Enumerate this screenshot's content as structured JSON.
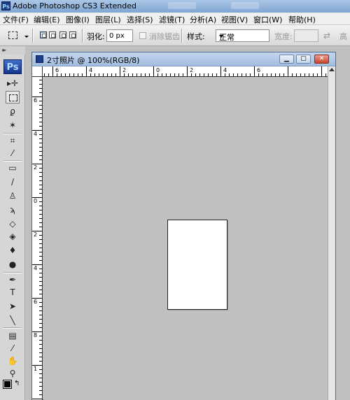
{
  "app": {
    "title": "Adobe Photoshop CS3 Extended",
    "icon_label": "Ps"
  },
  "menu": [
    "文件(F)",
    "编辑(E)",
    "图像(I)",
    "图层(L)",
    "选择(S)",
    "滤镜(T)",
    "分析(A)",
    "视图(V)",
    "窗口(W)",
    "帮助(H)"
  ],
  "options": {
    "feather_label": "羽化:",
    "feather_value": "0 px",
    "antialias_label": "消除锯齿",
    "style_label": "样式:",
    "style_value": "正常",
    "width_label": "宽度:",
    "height_label": "高"
  },
  "toolbox": {
    "logo": "Ps",
    "tools": [
      "move-icon",
      "rect-marquee-icon",
      "lasso-icon",
      "magic-wand-icon",
      "crop-icon",
      "eyedropper-icon",
      "healing-brush-icon",
      "brush-icon",
      "clone-stamp-icon",
      "history-brush-icon",
      "eraser-icon",
      "paint-bucket-icon",
      "blur-icon",
      "dodge-icon",
      "pen-icon",
      "type-icon",
      "path-selection-icon",
      "line-icon",
      "notes-icon",
      "eyedropper2-icon",
      "hand-icon",
      "zoom-icon"
    ]
  },
  "document": {
    "title": "2寸照片 @ 100%(RGB/8)",
    "ruler_h": [
      "6",
      "4",
      "2",
      "0",
      "2",
      "4",
      "6"
    ],
    "ruler_v": [
      "6",
      "4",
      "2",
      "0",
      "2",
      "4",
      "6",
      "8",
      "1"
    ]
  },
  "colors": {
    "foreground": "#000000",
    "background": "#ffffff",
    "canvas_bg": "#c0c0c0",
    "title_gradient": "#7fa5d2"
  }
}
